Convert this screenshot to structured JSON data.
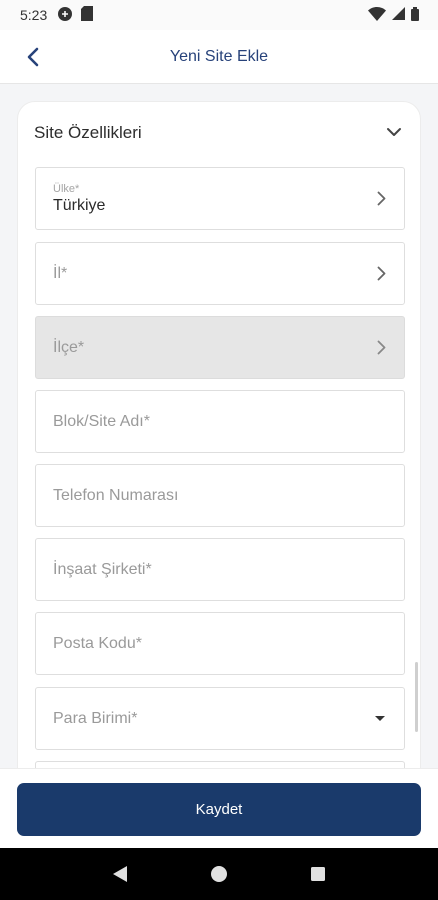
{
  "status_bar": {
    "time": "5:23",
    "icons": [
      "app-notification-icon",
      "sim-card-icon",
      "wifi-icon",
      "signal-icon",
      "battery-icon"
    ]
  },
  "app_bar": {
    "title": "Yeni Site Ekle",
    "back_icon": "chevron-left-icon"
  },
  "section": {
    "title": "Site Özellikleri",
    "toggle_icon": "chevron-down-icon"
  },
  "fields": [
    {
      "label": "Ülke*",
      "value": "Türkiye",
      "type": "select-page",
      "disabled": false
    },
    {
      "placeholder": "İl*",
      "type": "select-page",
      "disabled": false
    },
    {
      "placeholder": "İlçe*",
      "type": "select-page",
      "disabled": true
    },
    {
      "placeholder": "Blok/Site Adı*",
      "type": "text"
    },
    {
      "placeholder": "Telefon Numarası",
      "type": "text"
    },
    {
      "placeholder": "İnşaat Şirketi*",
      "type": "text"
    },
    {
      "placeholder": "Posta Kodu*",
      "type": "text"
    },
    {
      "placeholder": "Para Birimi*",
      "type": "dropdown"
    }
  ],
  "footer": {
    "save_label": "Kaydet"
  },
  "colors": {
    "primary": "#1a3a6b",
    "title": "#27427a",
    "disabled_field": "#e6e6e6"
  }
}
